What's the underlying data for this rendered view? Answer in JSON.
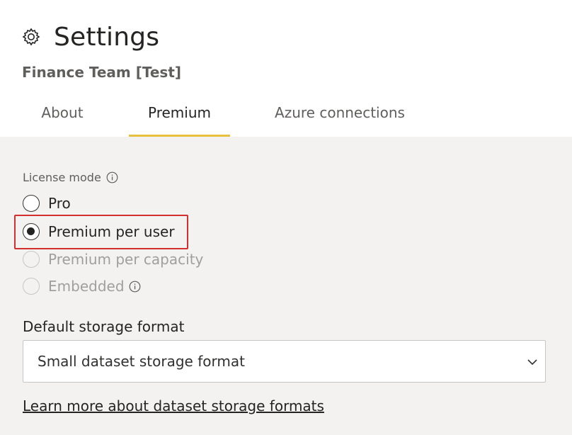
{
  "header": {
    "title": "Settings",
    "workspace_name": "Finance Team [Test]"
  },
  "tabs": [
    {
      "label": "About",
      "active": false
    },
    {
      "label": "Premium",
      "active": true
    },
    {
      "label": "Azure connections",
      "active": false
    }
  ],
  "license": {
    "label": "License mode",
    "options": [
      {
        "label": "Pro",
        "checked": false,
        "disabled": false
      },
      {
        "label": "Premium per user",
        "checked": true,
        "disabled": false
      },
      {
        "label": "Premium per capacity",
        "checked": false,
        "disabled": true
      },
      {
        "label": "Embedded",
        "checked": false,
        "disabled": true
      }
    ]
  },
  "storage": {
    "label": "Default storage format",
    "selected": "Small dataset storage format"
  },
  "learn_more": "Learn more about dataset storage formats",
  "colors": {
    "tab_underline": "#e8c13c",
    "highlight": "#d32f2f",
    "disabled_text": "#a19f9d",
    "panel_bg": "#f3f2f1"
  }
}
